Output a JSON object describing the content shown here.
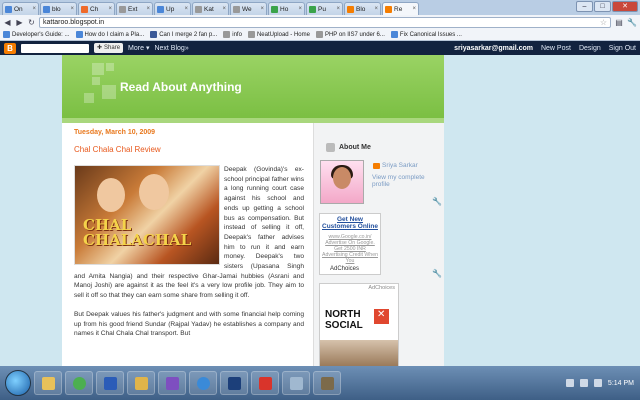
{
  "browser": {
    "tabs": [
      {
        "label": "On",
        "color": "#4a86d8"
      },
      {
        "label": "blo",
        "color": "#4a86d8"
      },
      {
        "label": "Ch",
        "color": "#ef6a2a"
      },
      {
        "label": "Ext",
        "color": "#999999"
      },
      {
        "label": "Up",
        "color": "#4a86d8"
      },
      {
        "label": "Kat",
        "color": "#999999"
      },
      {
        "label": "We",
        "color": "#999999"
      },
      {
        "label": "Ho",
        "color": "#3aa34a"
      },
      {
        "label": "Pu",
        "color": "#3aa34a"
      },
      {
        "label": "Blo",
        "color": "#f57d00"
      },
      {
        "label": "Re",
        "color": "#f57d00"
      }
    ],
    "url": "kattaroo.blogspot.in",
    "bookmarks": [
      {
        "label": "Developer's Guide: ...",
        "color": "#4a86d8"
      },
      {
        "label": "How do I claim a Pla...",
        "color": "#4a86d8"
      },
      {
        "label": "Can I merge 2 fan p...",
        "color": "#3b5998"
      },
      {
        "label": "info",
        "color": "#999999"
      },
      {
        "label": "NeatUpload - Home",
        "color": "#999999"
      },
      {
        "label": "PHP on IIS7 under 6...",
        "color": "#999999"
      },
      {
        "label": "Fix Canonical Issues ...",
        "color": "#4a86d8"
      }
    ]
  },
  "navbar": {
    "share_label": "Share",
    "more_label": "More ▾",
    "next_blog_label": "Next Blog»",
    "email": "sriyasarkar@gmail.com",
    "new_post_label": "New Post",
    "design_label": "Design",
    "sign_out_label": "Sign Out"
  },
  "blog": {
    "title": "Read About Anything",
    "post": {
      "date": "Tuesday, March 10, 2009",
      "title": "Chal Chala Chal Review",
      "poster_text": "CHAL CHALACHAL",
      "paragraph1": "Deepak (Govinda)'s ex-school principal father wins a long running court case against his school and ends up getting a school bus as compensation. But instead of selling it off, Deepak's father advises him to run it and earn money. Deepak's two sisters (Upasana Singh and Amita Nangia) and their respective Ghar-Jamai hubbies (Asrani and Manoj Joshi) are against it as the feel it's a very low profile job. They aim to sell it off so that they can earn some share from selling it off.",
      "paragraph2": "But Deepak values his father's judgment and with some financial help coming up from his good friend Sundar (Rajpal Yadav) he establishes a company and names it Chal Chala Chal transport. But"
    }
  },
  "sidebar": {
    "about_heading": "About Me",
    "profile_name": "Sriya Sarkar",
    "profile_link": "View my complete profile",
    "ad1": {
      "heading": "Get New Customers Online",
      "text": "www.Google.co.in/ Advertise On Google. Get 2500 INR Advertising Credit When You",
      "choices": "AdChoices"
    },
    "ad2": {
      "choices": "AdChoices",
      "brand": "NORTH SOCIAL"
    }
  },
  "taskbar": {
    "apps": [
      {
        "name": "explorer",
        "color": "#e8c15a"
      },
      {
        "name": "chrome",
        "color": "#4caf50"
      },
      {
        "name": "word",
        "color": "#2b5cb8"
      },
      {
        "name": "folder",
        "color": "#e0b44a"
      },
      {
        "name": "visual-studio",
        "color": "#7e4fc0"
      },
      {
        "name": "ie",
        "color": "#3a8ad8"
      },
      {
        "name": "photoshop",
        "color": "#1c3f7a"
      },
      {
        "name": "acrobat",
        "color": "#d9342b"
      },
      {
        "name": "notepad",
        "color": "#a0b8d0"
      },
      {
        "name": "tool",
        "color": "#7c6a4a"
      }
    ],
    "clock": "5:14 PM"
  }
}
